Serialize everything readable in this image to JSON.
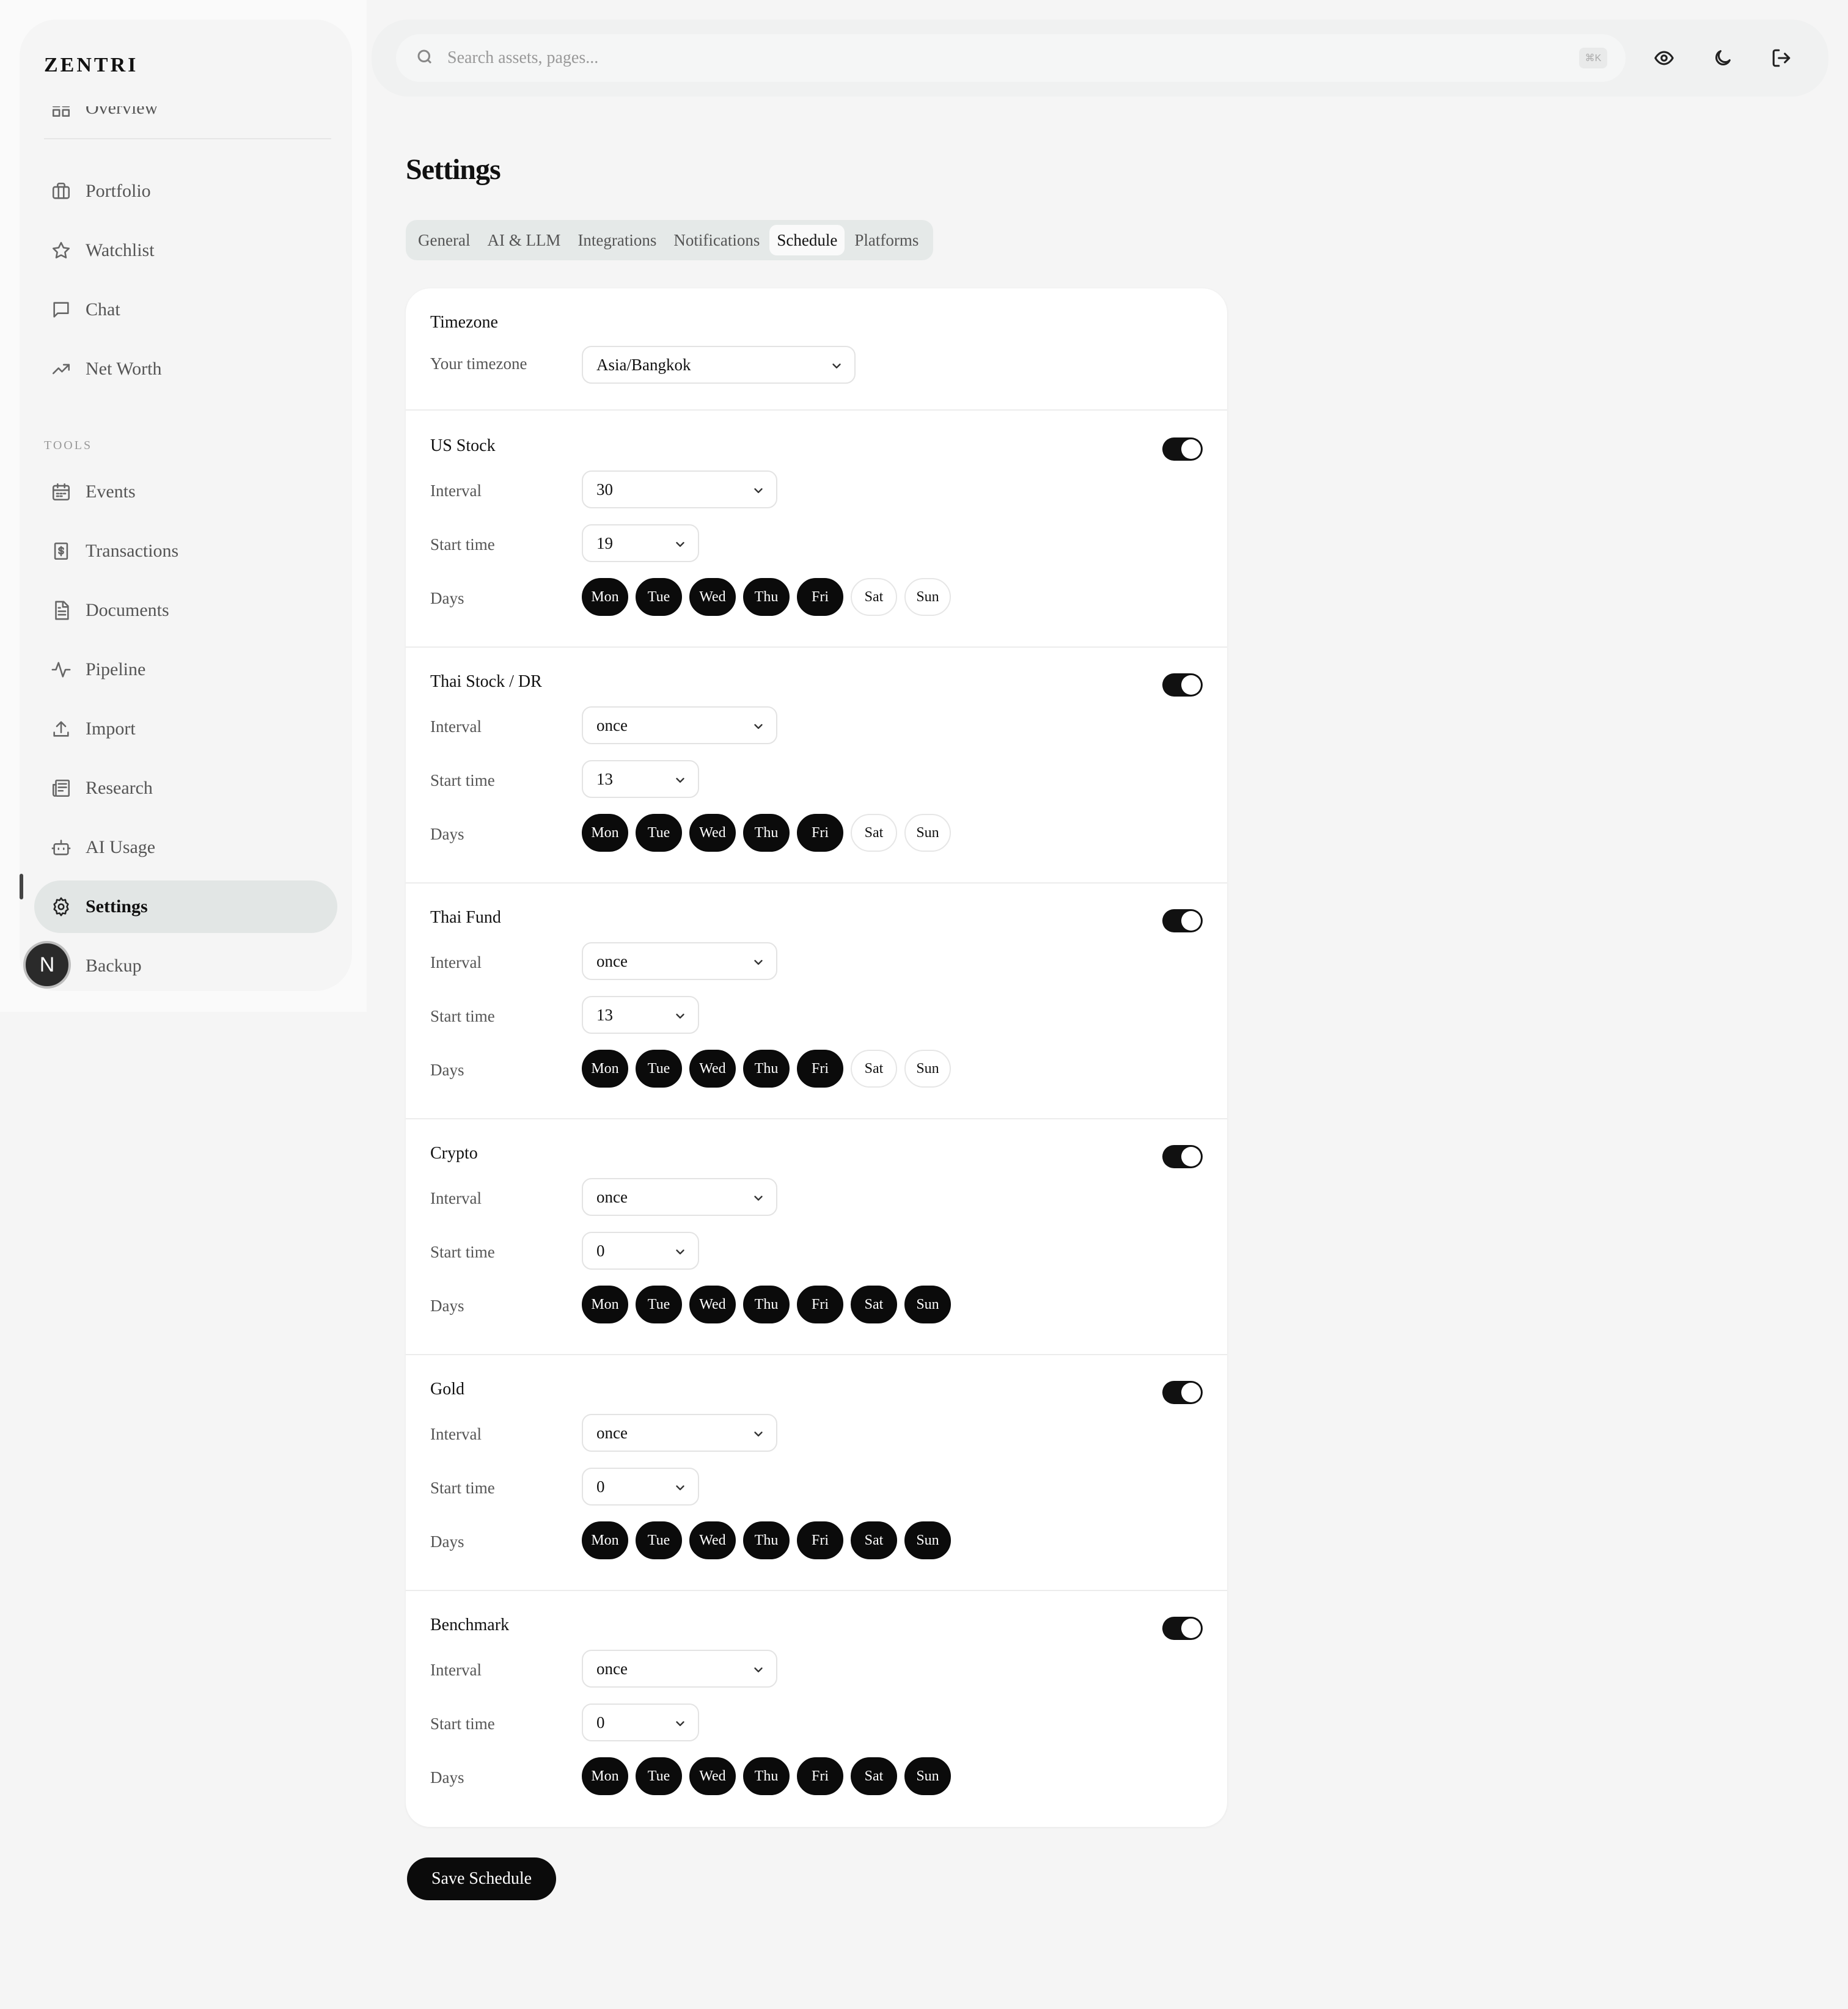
{
  "brand": "ZENTRI",
  "sidebar": {
    "clipped_item": "Overview",
    "main_items": [
      {
        "label": "Portfolio",
        "icon": "briefcase-icon"
      },
      {
        "label": "Watchlist",
        "icon": "star-icon"
      },
      {
        "label": "Chat",
        "icon": "chat-icon"
      },
      {
        "label": "Net Worth",
        "icon": "trending-up-icon"
      }
    ],
    "tools_label": "TOOLS",
    "tool_items": [
      {
        "label": "Events",
        "icon": "calendar-icon"
      },
      {
        "label": "Transactions",
        "icon": "receipt-icon"
      },
      {
        "label": "Documents",
        "icon": "document-icon"
      },
      {
        "label": "Pipeline",
        "icon": "activity-icon"
      },
      {
        "label": "Import",
        "icon": "upload-icon"
      },
      {
        "label": "Research",
        "icon": "newspaper-icon"
      },
      {
        "label": "AI Usage",
        "icon": "bot-icon"
      },
      {
        "label": "Settings",
        "icon": "gear-icon",
        "active": true
      },
      {
        "label": "Backup",
        "icon": "database-icon"
      }
    ],
    "avatar_letter": "N"
  },
  "topbar": {
    "search_placeholder": "Search assets, pages...",
    "shortcut": "⌘K"
  },
  "page": {
    "title": "Settings",
    "tabs": [
      "General",
      "AI & LLM",
      "Integrations",
      "Notifications",
      "Schedule",
      "Platforms"
    ],
    "active_tab": "Schedule"
  },
  "timezone": {
    "section_title": "Timezone",
    "label": "Your timezone",
    "value": "Asia/Bangkok"
  },
  "labels": {
    "interval": "Interval",
    "start_time": "Start time",
    "days": "Days"
  },
  "day_names": [
    "Mon",
    "Tue",
    "Wed",
    "Thu",
    "Fri",
    "Sat",
    "Sun"
  ],
  "schedules": [
    {
      "name": "US Stock",
      "enabled": true,
      "interval": "30",
      "start_time": "19",
      "days_on": [
        true,
        true,
        true,
        true,
        true,
        false,
        false
      ]
    },
    {
      "name": "Thai Stock / DR",
      "enabled": true,
      "interval": "once",
      "start_time": "13",
      "days_on": [
        true,
        true,
        true,
        true,
        true,
        false,
        false
      ]
    },
    {
      "name": "Thai Fund",
      "enabled": true,
      "interval": "once",
      "start_time": "13",
      "days_on": [
        true,
        true,
        true,
        true,
        true,
        false,
        false
      ]
    },
    {
      "name": "Crypto",
      "enabled": true,
      "interval": "once",
      "start_time": "0",
      "days_on": [
        true,
        true,
        true,
        true,
        true,
        true,
        true
      ]
    },
    {
      "name": "Gold",
      "enabled": true,
      "interval": "once",
      "start_time": "0",
      "days_on": [
        true,
        true,
        true,
        true,
        true,
        true,
        true
      ]
    },
    {
      "name": "Benchmark",
      "enabled": true,
      "interval": "once",
      "start_time": "0",
      "days_on": [
        true,
        true,
        true,
        true,
        true,
        true,
        true
      ]
    }
  ],
  "save_label": "Save Schedule"
}
